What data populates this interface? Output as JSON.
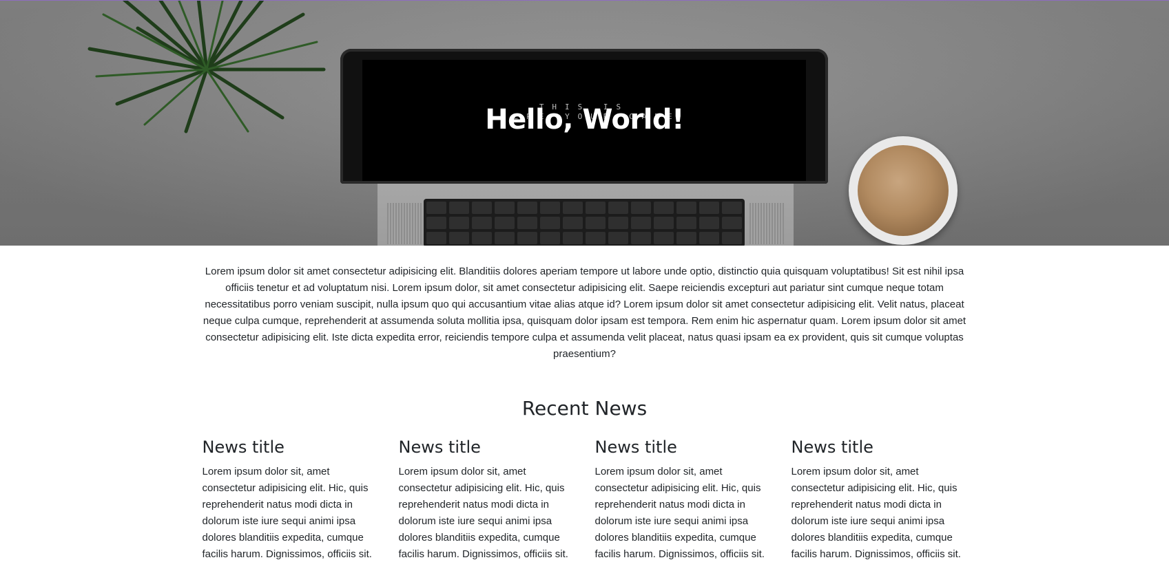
{
  "hero": {
    "title": "Hello, World!",
    "screen_line_1": "THIS IS",
    "screen_line_2": "WHERE YOUR CARE"
  },
  "intro": {
    "text": "Lorem ipsum dolor sit amet consectetur adipisicing elit. Blanditiis dolores aperiam tempore ut labore unde optio, distinctio quia quisquam voluptatibus! Sit est nihil ipsa officiis tenetur et ad voluptatum nisi. Lorem ipsum dolor, sit amet consectetur adipisicing elit. Saepe reiciendis excepturi aut pariatur sint cumque neque totam necessitatibus porro veniam suscipit, nulla ipsum quo qui accusantium vitae alias atque id? Lorem ipsum dolor sit amet consectetur adipisicing elit. Velit natus, placeat neque culpa cumque, reprehenderit at assumenda soluta mollitia ipsa, quisquam dolor ipsam est tempora. Rem enim hic aspernatur quam. Lorem ipsum dolor sit amet consectetur adipisicing elit. Iste dicta expedita error, reiciendis tempore culpa et assumenda velit placeat, natus quasi ipsam ea ex provident, quis sit cumque voluptas praesentium?"
  },
  "news": {
    "section_title": "Recent News",
    "items": [
      {
        "title": "News title",
        "body": "Lorem ipsum dolor sit, amet consectetur adipisicing elit. Hic, quis reprehenderit natus modi dicta in dolorum iste iure sequi animi ipsa dolores blanditiis expedita, cumque facilis harum. Dignissimos, officiis sit."
      },
      {
        "title": "News title",
        "body": "Lorem ipsum dolor sit, amet consectetur adipisicing elit. Hic, quis reprehenderit natus modi dicta in dolorum iste iure sequi animi ipsa dolores blanditiis expedita, cumque facilis harum. Dignissimos, officiis sit."
      },
      {
        "title": "News title",
        "body": "Lorem ipsum dolor sit, amet consectetur adipisicing elit. Hic, quis reprehenderit natus modi dicta in dolorum iste iure sequi animi ipsa dolores blanditiis expedita, cumque facilis harum. Dignissimos, officiis sit."
      },
      {
        "title": "News title",
        "body": "Lorem ipsum dolor sit, amet consectetur adipisicing elit. Hic, quis reprehenderit natus modi dicta in dolorum iste iure sequi animi ipsa dolores blanditiis expedita, cumque facilis harum. Dignissimos, officiis sit."
      }
    ]
  },
  "colors": {
    "text": "#212529",
    "hero_title": "#ffffff",
    "top_border": "#8e6cc0"
  }
}
